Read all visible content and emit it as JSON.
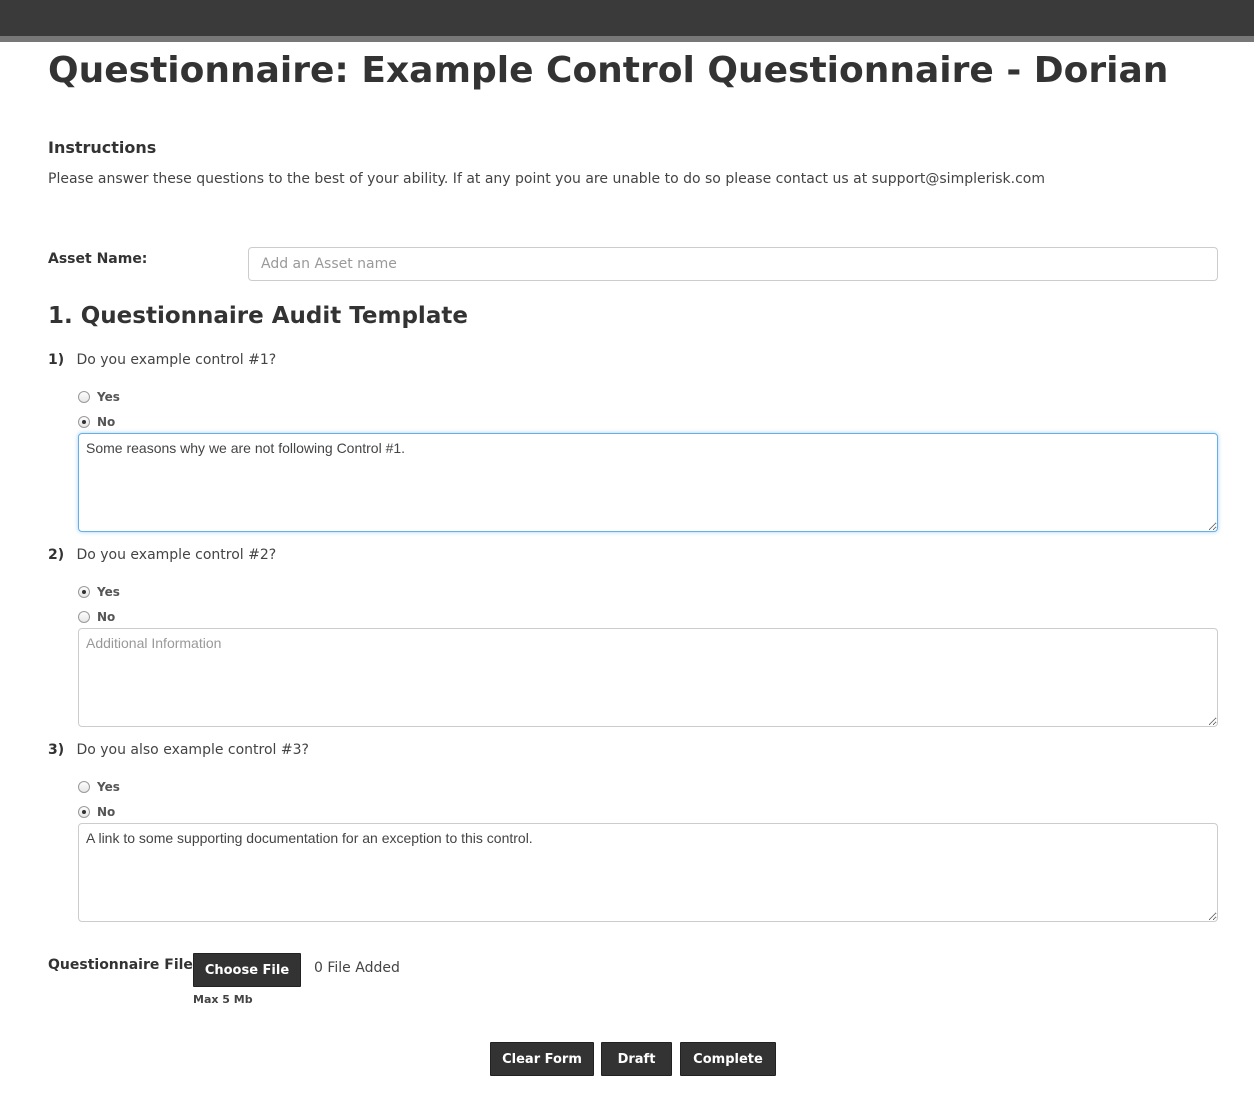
{
  "page": {
    "title": "Questionnaire: Example Control Questionnaire - Dorian"
  },
  "instructions": {
    "heading": "Instructions",
    "text": "Please answer these questions to the best of your ability. If at any point you are unable to do so please contact us at support@simplerisk.com"
  },
  "asset": {
    "label": "Asset Name:",
    "placeholder": "Add an Asset name",
    "value": ""
  },
  "section": {
    "heading": "1. Questionnaire Audit Template"
  },
  "questions": [
    {
      "number": "1)",
      "text": "Do you example control #1?",
      "options": [
        "Yes",
        "No"
      ],
      "selected": "No",
      "answer": "Some reasons why we are not following Control #1.",
      "placeholder": "Additional Information"
    },
    {
      "number": "2)",
      "text": "Do you example control #2?",
      "options": [
        "Yes",
        "No"
      ],
      "selected": "Yes",
      "answer": "",
      "placeholder": "Additional Information"
    },
    {
      "number": "3)",
      "text": "Do you also example control #3?",
      "options": [
        "Yes",
        "No"
      ],
      "selected": "No",
      "answer": "A link to some supporting documentation for an exception to this control.",
      "placeholder": "Additional Information"
    }
  ],
  "files": {
    "label": "Questionnaire Files:",
    "choose_label": "Choose File",
    "count_text": "0 File Added",
    "max_note": "Max 5 Mb"
  },
  "actions": {
    "clear_label": "Clear Form",
    "draft_label": "Draft",
    "complete_label": "Complete"
  },
  "colors": {
    "topbar": "#3a3a3a",
    "button": "#333333",
    "focus": "#66afe9"
  }
}
